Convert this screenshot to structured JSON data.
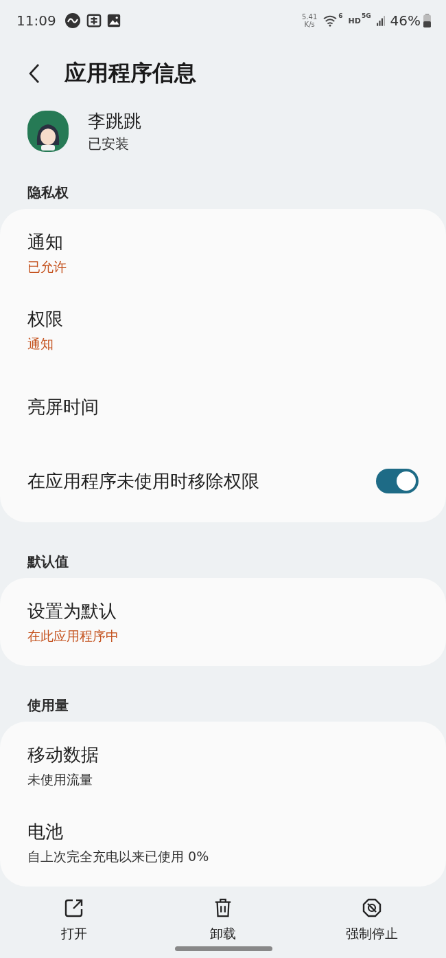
{
  "status_bar": {
    "time": "11:09",
    "net_speed": "5.41",
    "net_unit": "K/s",
    "wifi_label": "6",
    "hd": "HD",
    "network": "5G",
    "battery": "46%"
  },
  "header": {
    "title": "应用程序信息"
  },
  "app": {
    "name": "李跳跳",
    "status": "已安装"
  },
  "sections": [
    {
      "header": "隐私权",
      "items": [
        {
          "kind": "text",
          "title": "通知",
          "subtitle": "已允许",
          "color": "#c4521e"
        },
        {
          "kind": "text",
          "title": "权限",
          "subtitle": "通知",
          "color": "#c4521e"
        },
        {
          "kind": "text",
          "title": "亮屏时间"
        },
        {
          "kind": "toggle",
          "title": "在应用程序未使用时移除权限",
          "on": true
        }
      ]
    },
    {
      "header": "默认值",
      "items": [
        {
          "kind": "text",
          "title": "设置为默认",
          "subtitle": "在此应用程序中",
          "color": "#c4521e"
        }
      ]
    },
    {
      "header": "使用量",
      "items": [
        {
          "kind": "text",
          "title": "移动数据",
          "subtitle": "未使用流量",
          "color": "#333333"
        },
        {
          "kind": "text",
          "title": "电池",
          "subtitle": "自上次完全充电以来已使用 0%",
          "color": "#333333"
        }
      ]
    }
  ],
  "actions": [
    {
      "kind": "open",
      "label": "打开"
    },
    {
      "kind": "uninstall",
      "label": "卸载"
    },
    {
      "kind": "stop",
      "label": "强制停止"
    }
  ]
}
